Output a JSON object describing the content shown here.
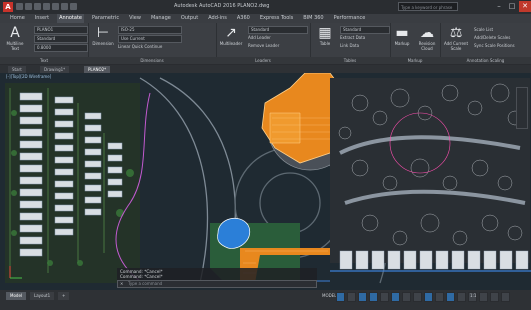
{
  "title_bar": {
    "app_letter": "A",
    "title": "Autodesk AutoCAD 2016  PLANO2.dwg",
    "search_placeholder": "Type a keyword or phrase",
    "min": "–",
    "max": "□",
    "close": "✕"
  },
  "menu": [
    "Home",
    "Insert",
    "Annotate",
    "Parametric",
    "View",
    "Manage",
    "Output",
    "Add-ins",
    "A360",
    "Express Tools",
    "BIM 360",
    "Performance"
  ],
  "ribbon": {
    "text_panel": {
      "mtext": "Multiline",
      "mtext2": "Text",
      "style": "PLANO1",
      "size": "Standard",
      "height": "0.8000",
      "title": "Text"
    },
    "dim_panel": {
      "dimension": "Dimension",
      "style": "ISO-25",
      "layer": "Use Current",
      "linear": "Linear",
      "quick": "Quick",
      "continue": "Continue",
      "title": "Dimensions"
    },
    "leader_panel": {
      "multileader": "Multileader",
      "style": "Standard",
      "add": "Add Leader",
      "remove": "Remove Leader",
      "title": "Leaders"
    },
    "table_panel": {
      "table": "Table",
      "style": "Standard",
      "extract": "Extract Data",
      "link": "Link Data",
      "title": "Tables"
    },
    "markup_panel": {
      "markup": "Markup",
      "cloud": "Revision Cloud",
      "title": "Markup"
    },
    "scale_panel": {
      "add": "Add Current Scale",
      "list": "Scale List",
      "sync": "Add/Delete Scales",
      "sync2": "Sync Scale Positions",
      "title": "Annotation Scaling"
    }
  },
  "tabs": [
    {
      "label": "Start"
    },
    {
      "label": "Drawing1*"
    },
    {
      "label": "PLANO2*"
    }
  ],
  "viewport": {
    "label": "[-][Top][2D Wireframe]"
  },
  "command": {
    "history": [
      "Command: *Cancel*",
      "Command: *Cancel*"
    ],
    "placeholder": "Type a command"
  },
  "layouts": [
    {
      "label": "Model"
    },
    {
      "label": "Layout1"
    }
  ],
  "status": {
    "model": "MODEL",
    "scale": "1:1"
  },
  "colors": {
    "ribbon_bg": "#3c3f44",
    "viewport_bg": "#202a33",
    "accent_orange": "#e8881e"
  }
}
